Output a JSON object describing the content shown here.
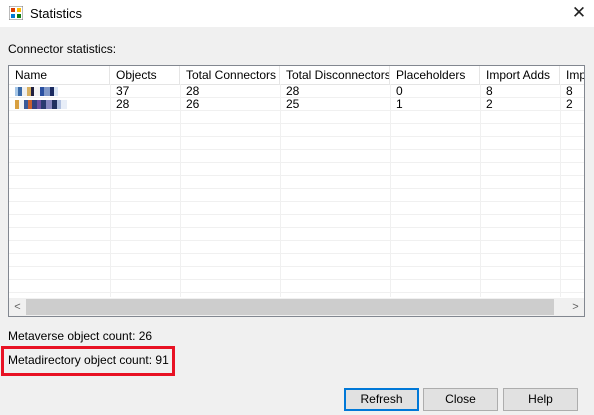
{
  "window": {
    "title": "Statistics"
  },
  "section_label": "Connector statistics:",
  "table": {
    "columns": [
      "Name",
      "Objects",
      "Total Connectors",
      "Total Disconnectors",
      "Placeholders",
      "Import Adds",
      "Imp"
    ],
    "rows": [
      [
        "",
        "37",
        "28",
        "28",
        "0",
        "8",
        "8"
      ],
      [
        "",
        "28",
        "26",
        "25",
        "1",
        "2",
        "2"
      ]
    ]
  },
  "metaverse_count": "Metaverse object count: 26",
  "metadirectory_count": "Metadirectory object count: 91",
  "buttons": {
    "refresh": "Refresh",
    "close": "Close",
    "help": "Help"
  },
  "scrollbar": {
    "left_arrow": "<",
    "right_arrow": ">"
  },
  "close_glyph": "✕",
  "colors": {
    "highlight": "#e81123",
    "default_button_border": "#0078d7"
  }
}
